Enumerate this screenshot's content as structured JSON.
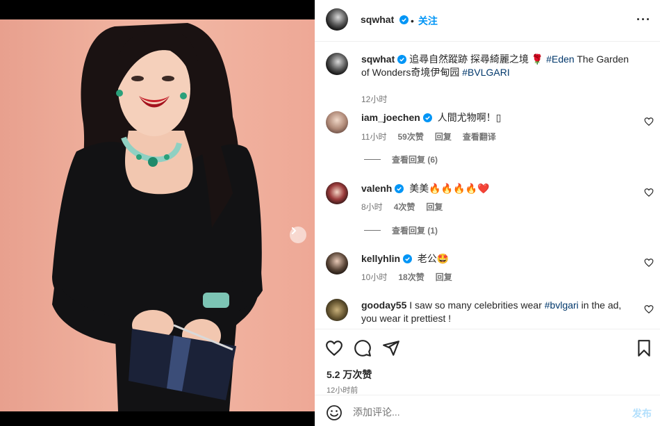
{
  "post": {
    "username": "sqwhat",
    "follow_separator": "•",
    "follow_label": "关注",
    "more_label": "···",
    "caption_lead": "追尋自然蹤跡 探尋綺麗之境 🌹 ",
    "caption_tag1": "#Eden",
    "caption_mid": " The Garden of Wonders奇境伊甸园 ",
    "caption_tag2": "#BVLGARI",
    "caption_time": "12小时"
  },
  "comments": [
    {
      "username": "iam_joechen",
      "text": "人間尤物啊！▯",
      "time": "11小时",
      "likes": "59次赞",
      "reply": "回复",
      "translate": "查看翻译",
      "view_replies": "查看回复 (6)"
    },
    {
      "username": "valenh",
      "text": "美美🔥🔥🔥🔥❤️",
      "time": "8小时",
      "likes": "4次赞",
      "reply": "回复",
      "view_replies": "查看回复 (1)"
    },
    {
      "username": "kellyhlin",
      "text": "老公🤩",
      "time": "10小时",
      "likes": "18次赞",
      "reply": "回复"
    },
    {
      "username": "gooday55",
      "text_lead": " I saw so many celebrities wear ",
      "tag": "#bvlgari",
      "text_tail": " in the ad, you wear it prettiest !"
    }
  ],
  "footer": {
    "likes": "5.2 万次赞",
    "ago": "12小时前",
    "comment_placeholder": "添加评论...",
    "post_label": "发布"
  },
  "carousel": {
    "total": 4,
    "active": 1
  },
  "colors": {
    "link_blue": "#0095f6",
    "hashtag": "#00376b",
    "muted": "#737373",
    "post_disabled": "#b2dffc",
    "verified": "#0095f6"
  },
  "icons": [
    "chevron-right-icon",
    "verified-icon",
    "more-icon",
    "heart-icon",
    "comment-icon",
    "share-icon",
    "bookmark-icon",
    "emoji-icon"
  ]
}
